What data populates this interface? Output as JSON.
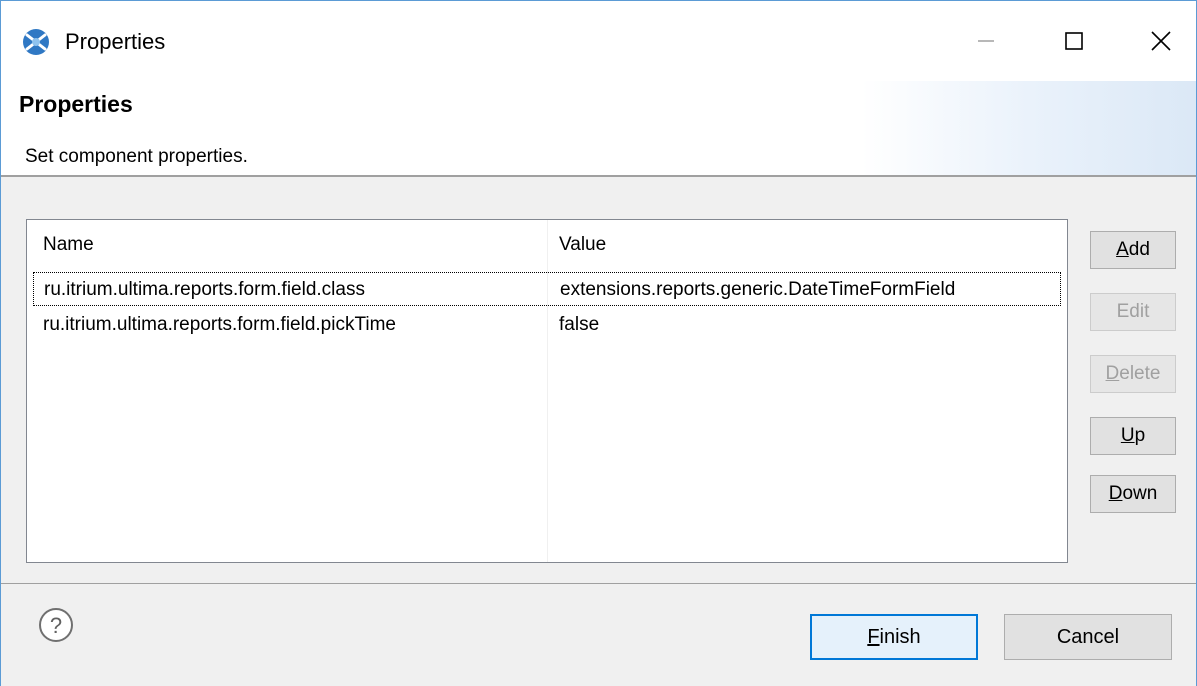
{
  "window": {
    "title": "Properties",
    "controls": {
      "minimize": "minimize",
      "maximize": "maximize",
      "close": "close"
    }
  },
  "header": {
    "title": "Properties",
    "description": "Set component properties."
  },
  "table": {
    "columns": [
      "Name",
      "Value"
    ],
    "rows": [
      {
        "name": "ru.itrium.ultima.reports.form.field.class",
        "value": "extensions.reports.generic.DateTimeFormField"
      },
      {
        "name": "ru.itrium.ultima.reports.form.field.pickTime",
        "value": "false"
      }
    ]
  },
  "side_buttons": {
    "add": {
      "first": "A",
      "rest": "dd"
    },
    "edit": {
      "first": "",
      "rest": "Edit"
    },
    "delete": {
      "first": "D",
      "rest": "elete"
    },
    "up": {
      "first": "U",
      "rest": "p"
    },
    "down": {
      "first": "D",
      "rest": "own"
    }
  },
  "footer": {
    "finish": {
      "first": "F",
      "rest": "inish"
    },
    "cancel": "Cancel"
  },
  "colors": {
    "border": "#5b9bd5",
    "accent": "#0078d7",
    "panel": "#f0f0f0",
    "disabled_text": "#a0a0a0"
  },
  "icons": {
    "app": "eclipse-app-icon",
    "help": "help-icon"
  }
}
